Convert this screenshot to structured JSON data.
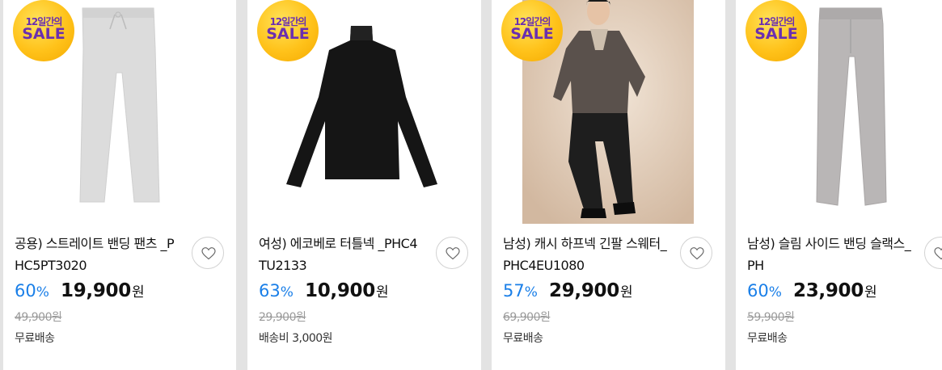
{
  "badge": {
    "top": "12일간의",
    "main": "SALE"
  },
  "colors": {
    "accent_blue": "#1a7fe8",
    "badge_yellow": "#ffc21a",
    "badge_text": "#6a2fb0"
  },
  "products": [
    {
      "title": "공용) 스트레이트 밴딩 팬츠 _PHC5PT3020",
      "discount": "60",
      "discount_unit": "%",
      "price": "19,900",
      "price_unit": "원",
      "original_price": "49,900원",
      "shipping": "무료배송",
      "image_icon": "light-gray-pants"
    },
    {
      "title": "여성) 에코베로 터틀넥 _PHC4TU2133",
      "discount": "63",
      "discount_unit": "%",
      "price": "10,900",
      "price_unit": "원",
      "original_price": "29,900원",
      "shipping": "배송비 3,000원",
      "image_icon": "black-turtleneck"
    },
    {
      "title": "남성) 캐시 하프넥 긴팔 스웨터_PHC4EU1080",
      "discount": "57",
      "discount_unit": "%",
      "price": "29,900",
      "price_unit": "원",
      "original_price": "69,900원",
      "shipping": "무료배송",
      "image_icon": "model-photo"
    },
    {
      "title": "남성) 슬림 사이드 밴딩 슬랙스_PH",
      "discount": "60",
      "discount_unit": "%",
      "price": "23,900",
      "price_unit": "원",
      "original_price": "59,900원",
      "shipping": "무료배송",
      "image_icon": "gray-slacks"
    }
  ]
}
